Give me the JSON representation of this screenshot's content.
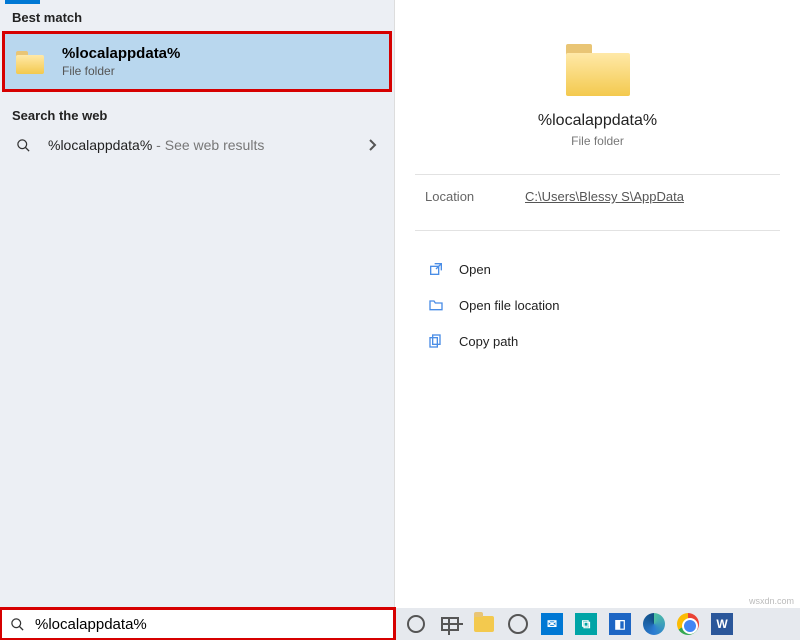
{
  "left": {
    "best_match_header": "Best match",
    "best_match": {
      "title": "%localappdata%",
      "subtitle": "File folder"
    },
    "web_header": "Search the web",
    "web_result": {
      "text": "%localappdata%",
      "suffix": " - See web results"
    }
  },
  "preview": {
    "title": "%localappdata%",
    "subtitle": "File folder",
    "location_label": "Location",
    "location_value": "C:\\Users\\Blessy S\\AppData"
  },
  "actions": {
    "open": "Open",
    "open_file_location": "Open file location",
    "copy_path": "Copy path"
  },
  "search": {
    "value": "%localappdata%"
  },
  "watermark": "wsxdn.com"
}
